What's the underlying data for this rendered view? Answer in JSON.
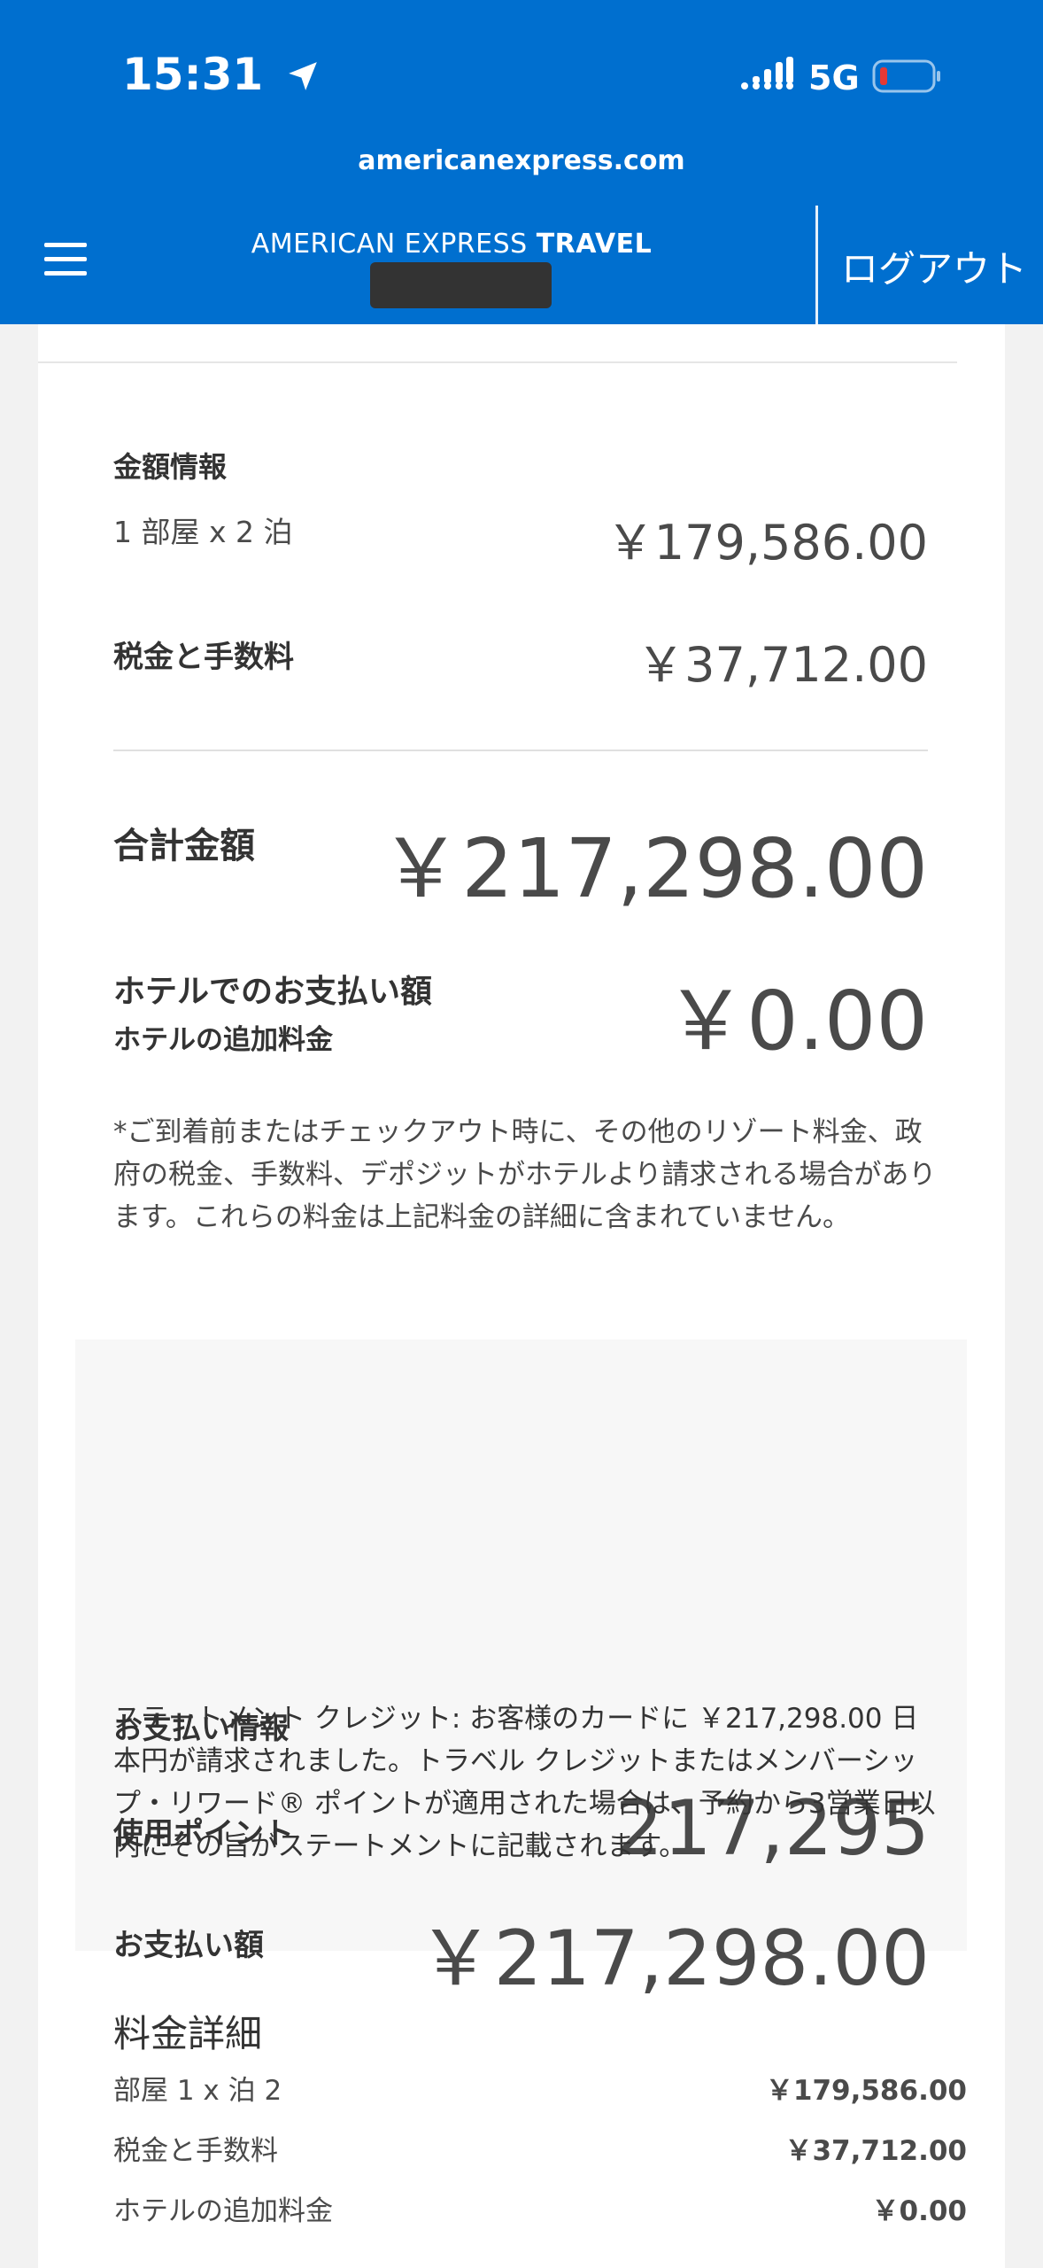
{
  "status": {
    "time": "15:31",
    "network": "5G"
  },
  "header": {
    "url": "americanexpress.com",
    "brand_regular": "AMERICAN EXPRESS ",
    "brand_bold": "TRAVEL",
    "logout_label": "ログアウト"
  },
  "summary": {
    "section_title": "金額情報",
    "room_nights_label": "1 部屋 x 2 泊",
    "room_nights_value": "￥179,586.00",
    "taxes_label": "税金と手数料",
    "taxes_value": "￥37,712.00",
    "total_label": "合計金額",
    "total_value": "￥217,298.00",
    "hotel_pay_label": "ホテルでのお支払い額",
    "hotel_extra_label": "ホテルの追加料金",
    "hotel_pay_value": "￥0.00",
    "note": "*ご到着前またはチェックアウト時に、その他のリゾート料金、政府の税金、手数料、デポジットがホテルより請求される場合があります。これらの料金は上記料金の詳細に含まれていません。"
  },
  "payment": {
    "section_title": "お支払い情報",
    "points_label": "使用ポイント",
    "points_value": "217,295",
    "amount_label": "お支払い額",
    "amount_value": "￥217,298.00",
    "statement": "ステートメント クレジット: お客様のカードに ￥217,298.00 日本円が請求されました。トラベル クレジットまたはメンバーシップ・リワード® ポイントが適用された場合は、予約から3営業日以内にその旨がステートメントに記載されます。"
  },
  "fees": {
    "title": "料金詳細",
    "rows": [
      {
        "label": "部屋 1 x 泊 2",
        "value": "￥179,586.00"
      },
      {
        "label": "税金と手数料",
        "value": "￥37,712.00"
      },
      {
        "label": "ホテルの追加料金",
        "value": "￥0.00"
      }
    ]
  }
}
